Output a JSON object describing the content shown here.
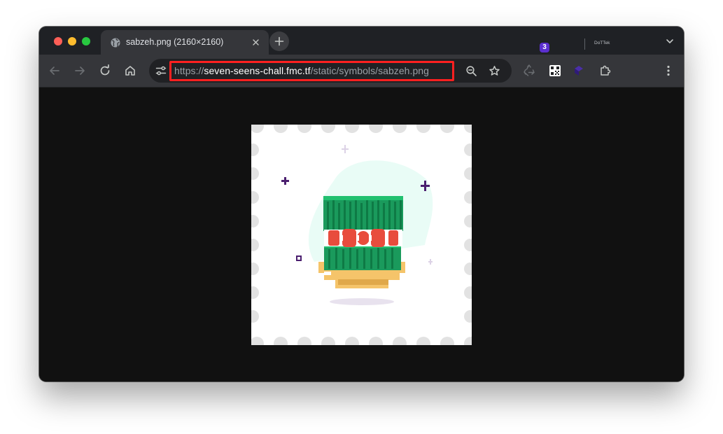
{
  "window": {
    "tab": {
      "title": "sabzeh.png (2160×2160)",
      "favicon": "globe-icon",
      "close_icon": "close-icon"
    },
    "new_tab_icon": "plus-icon",
    "tab_search_icon": "chevron-down-icon"
  },
  "toolbar": {
    "back_icon": "arrow-left-icon",
    "forward_icon": "arrow-right-icon",
    "reload_icon": "reload-icon",
    "home_icon": "home-icon",
    "site_info_icon": "tune-icon",
    "url": {
      "scheme": "https://",
      "host": "seven-seens-chall.fmc.tf",
      "path": "/static/symbols/sabzeh.png"
    },
    "zoom_icon": "zoom-out-icon",
    "bookmark_icon": "star-icon",
    "extensions": [
      {
        "name": "recycle-icon"
      },
      {
        "name": "qr-code-icon"
      },
      {
        "name": "extension-badge-icon",
        "badge": "3"
      },
      {
        "name": "puzzle-icon"
      }
    ],
    "profile_label": "DoTTek",
    "menu_icon": "kebab-menu-icon"
  },
  "content": {
    "image": "sabzeh-illustration"
  },
  "colors": {
    "highlight": "#ff2020",
    "tab_bg": "#35363a",
    "toolbar_bg": "#35363a",
    "page_bg": "#111111",
    "badge": "#5b2fcf"
  }
}
